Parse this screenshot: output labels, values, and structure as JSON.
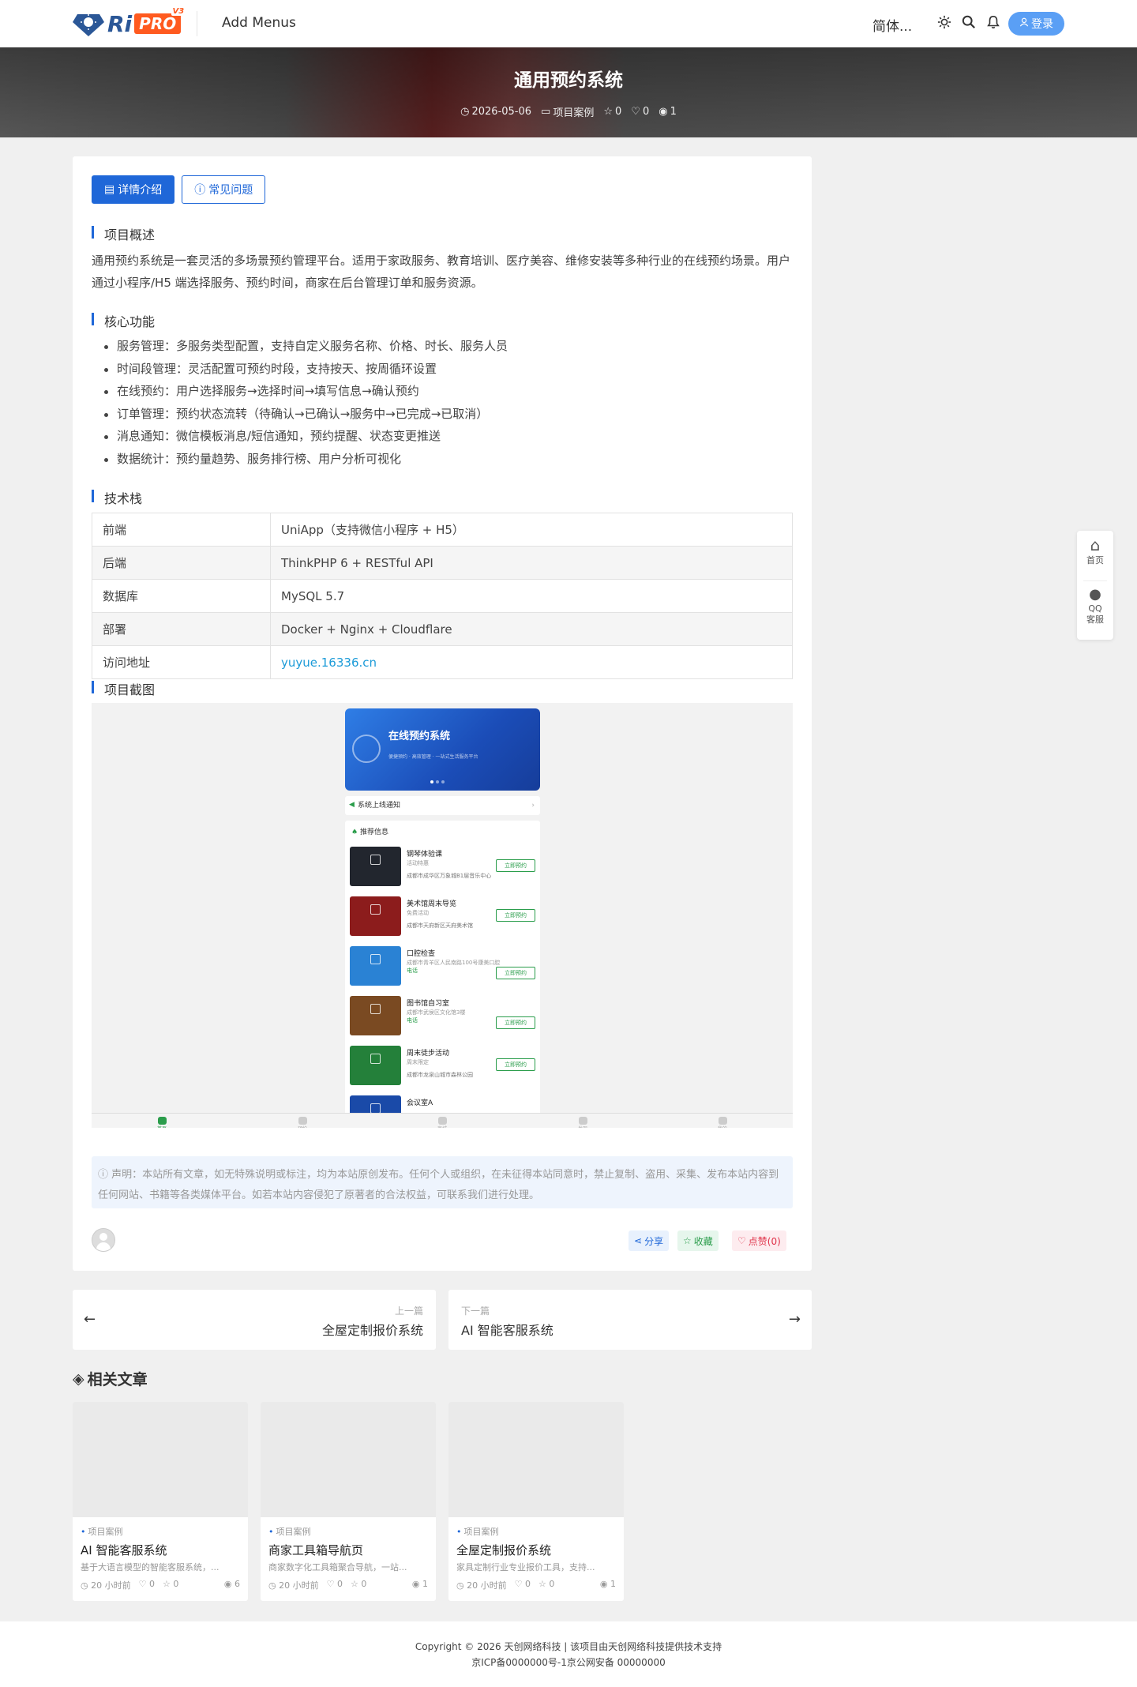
{
  "header": {
    "logo_text": "Ri",
    "logo_pro": "PRO",
    "logo_version": "V3",
    "add_menus": "Add Menus",
    "language": "简体...",
    "login_label": "登录"
  },
  "hero": {
    "title": "通用预约系统",
    "date": "2026-05-06",
    "category": "项目案例",
    "favorites": "0",
    "likes": "0",
    "views": "1"
  },
  "tabs": [
    {
      "label": "详情介绍",
      "icon": "document-icon",
      "active": true
    },
    {
      "label": "常见问题",
      "icon": "question-circle-icon",
      "active": false
    }
  ],
  "article": {
    "overview_heading": "项目概述",
    "overview_text": "通用预约系统是一套灵活的多场景预约管理平台。适用于家政服务、教育培训、医疗美容、维修安装等多种行业的在线预约场景。用户通过小程序/H5 端选择服务、预约时间，商家在后台管理订单和服务资源。",
    "features_heading": "核心功能",
    "features": [
      "服务管理：多服务类型配置，支持自定义服务名称、价格、时长、服务人员",
      "时间段管理：灵活配置可预约时段，支持按天、按周循环设置",
      "在线预约：用户选择服务→选择时间→填写信息→确认预约",
      "订单管理：预约状态流转（待确认→已确认→服务中→已完成→已取消）",
      "消息通知：微信模板消息/短信通知，预约提醒、状态变更推送",
      "数据统计：预约量趋势、服务排行榜、用户分析可视化"
    ],
    "tech_heading": "技术栈",
    "tech_table": [
      {
        "k": "前端",
        "v": "UniApp（支持微信小程序 + H5）"
      },
      {
        "k": "后端",
        "v": "ThinkPHP 6 + RESTful API"
      },
      {
        "k": "数据库",
        "v": "MySQL 5.7"
      },
      {
        "k": "部署",
        "v": "Docker + Nginx + Cloudflare"
      },
      {
        "k": "访问地址",
        "v": "yuyue.16336.cn"
      }
    ],
    "screenshot_heading": "项目截图"
  },
  "screenshot": {
    "banner_title": "在线预约系统",
    "banner_sub": "便捷预约 · 高效管理 · 一站式生活服务平台",
    "notice": "系统上线通知",
    "rec_heading": "推荐信息",
    "items": [
      {
        "title": "钢琴体验课",
        "sub": "活动特惠",
        "green": "",
        "addr": "成都市成华区万象城B1层音乐中心",
        "btn": "立即预约",
        "color": "#22262e"
      },
      {
        "title": "美术馆周末导览",
        "sub": "免费活动",
        "green": "",
        "addr": "成都市天府新区天府美术馆",
        "btn": "立即预约",
        "color": "#8c1c1c"
      },
      {
        "title": "口腔检查",
        "sub": "成都市青羊区人民南路100号康美口腔",
        "green": "电话",
        "addr": "",
        "btn": "立即预约",
        "color": "#2a82d4"
      },
      {
        "title": "图书馆自习室",
        "sub": "成都市武侯区文化馆3楼",
        "green": "电话",
        "addr": "",
        "btn": "立即预约",
        "color": "#7a4a22"
      },
      {
        "title": "周末徒步活动",
        "sub": "周末限定",
        "green": "",
        "addr": "成都市龙泉山城市森林公园",
        "btn": "立即预约",
        "color": "#24803a"
      },
      {
        "title": "会议室A",
        "sub": "",
        "green": "",
        "addr": "",
        "btn": "",
        "color": "#1a4aa8"
      }
    ],
    "tabbar": [
      "首页",
      "预约",
      "商城",
      "发现",
      "我的"
    ]
  },
  "disclaimer": "声明：本站所有文章，如无特殊说明或标注，均为本站原创发布。任何个人或组织，在未征得本站同意时，禁止复制、盗用、采集、发布本站内容到任何网站、书籍等各类媒体平台。如若本站内容侵犯了原著者的合法权益，可联系我们进行处理。",
  "actions": {
    "share": "分享",
    "collect": "收藏",
    "like": "点赞(0)"
  },
  "post_nav": {
    "prev_label": "上一篇",
    "prev_title": "全屋定制报价系统",
    "next_label": "下一篇",
    "next_title": "AI 智能客服系统"
  },
  "related": {
    "heading": "相关文章",
    "items": [
      {
        "cat": "项目案例",
        "title": "AI 智能客服系统",
        "excerpt": "基于大语言模型的智能客服系统，...",
        "time": "20 小时前",
        "likes": "0",
        "favs": "0",
        "views": "6"
      },
      {
        "cat": "项目案例",
        "title": "商家工具箱导航页",
        "excerpt": "商家数字化工具箱聚合导航，一站...",
        "time": "20 小时前",
        "likes": "0",
        "favs": "0",
        "views": "1"
      },
      {
        "cat": "项目案例",
        "title": "全屋定制报价系统",
        "excerpt": "家具定制行业专业报价工具，支持...",
        "time": "20 小时前",
        "likes": "0",
        "favs": "0",
        "views": "1"
      }
    ]
  },
  "float_bar": {
    "home": "首页",
    "qq": "QQ客服"
  },
  "footer": {
    "line1": "Copyright © 2026 天创网络科技 | 该项目由天创网络科技提供技术支持",
    "line2": "京ICP备0000000号-1京公网安备 00000000"
  },
  "colors": {
    "accent": "#1f67d8",
    "link": "#1c9bd8",
    "green": "#2a9d4b",
    "danger": "#e0334a"
  }
}
